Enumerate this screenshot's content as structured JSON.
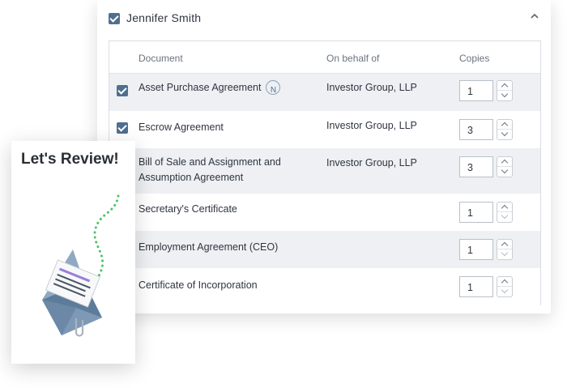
{
  "header": {
    "name": "Jennifer Smith"
  },
  "table": {
    "columns": {
      "document": "Document",
      "behalf": "On behalf of",
      "copies": "Copies"
    },
    "rows": [
      {
        "document": "Asset Purchase Agreement",
        "badge": "N",
        "behalf": "Investor Group, LLP",
        "copies": "1",
        "checked": true
      },
      {
        "document": "Escrow Agreement",
        "behalf": "Investor Group, LLP",
        "copies": "3",
        "checked": true
      },
      {
        "document": "Bill of Sale and Assignment and",
        "document_line2": "Assumption Agreement",
        "behalf": "Investor Group, LLP",
        "copies": "3",
        "checked": false
      },
      {
        "document": "Secretary's Certificate",
        "behalf": "",
        "copies": "1",
        "checked": false
      },
      {
        "document": "Employment Agreement (CEO)",
        "behalf": "",
        "copies": "1",
        "checked": false
      },
      {
        "document": "Certificate of Incorporation",
        "behalf": "",
        "copies": "1",
        "checked": false
      }
    ]
  },
  "review_card": {
    "title": "Let's Review!"
  },
  "colors": {
    "accent": "#4f6f8f",
    "row_alt": "#eef0f3",
    "dots": "#4cc26a"
  },
  "icons": [
    "checkbox-icon",
    "chevron-up-icon",
    "stepper-up-icon",
    "stepper-down-icon",
    "n-badge-icon",
    "envelope-illustration"
  ]
}
